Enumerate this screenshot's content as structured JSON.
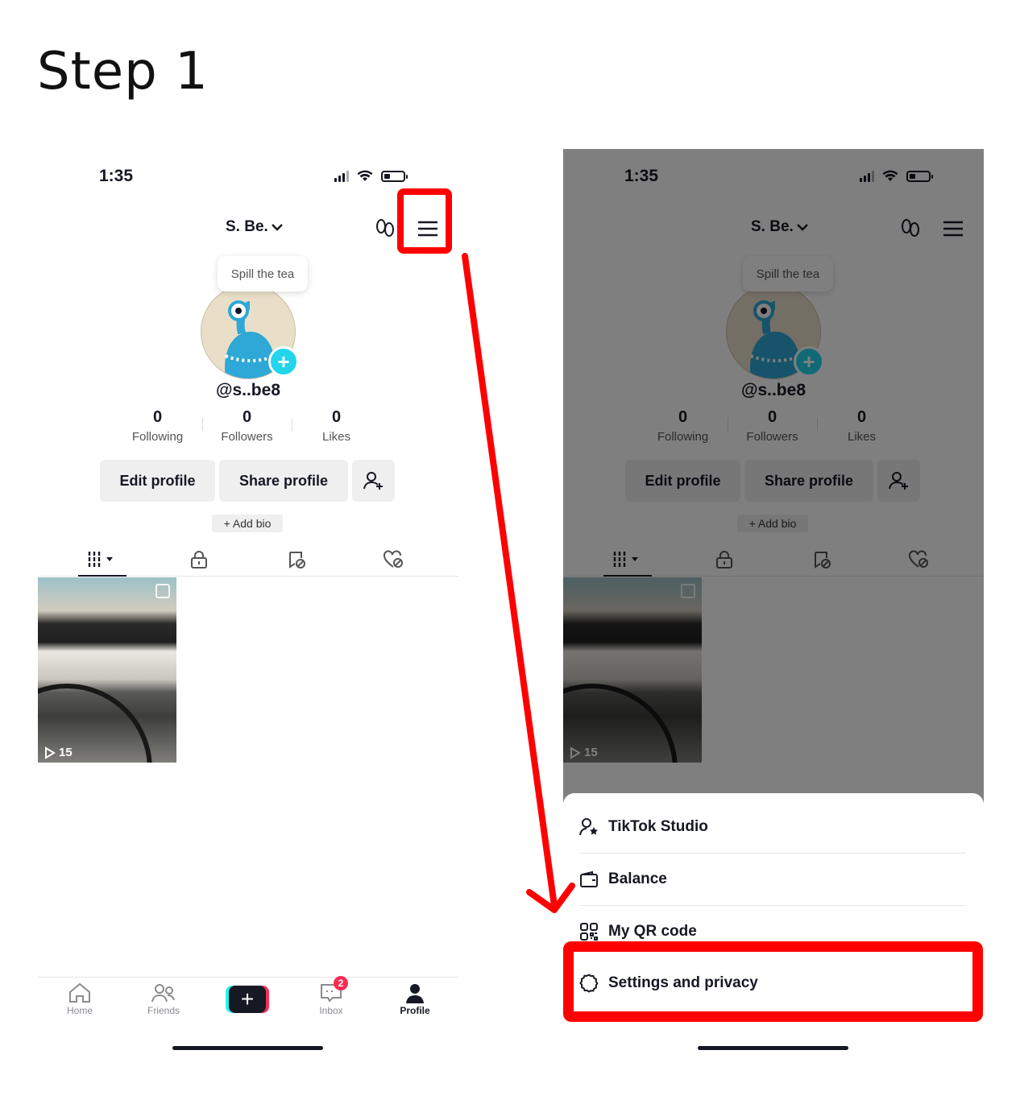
{
  "page_title": "Step 1",
  "status": {
    "time": "1:35"
  },
  "profile": {
    "display_name": "S. Be.",
    "bubble": "Spill the tea",
    "handle": "@s..be8",
    "stats": [
      {
        "value": "0",
        "label": "Following"
      },
      {
        "value": "0",
        "label": "Followers"
      },
      {
        "value": "0",
        "label": "Likes"
      }
    ],
    "edit_label": "Edit profile",
    "share_label": "Share profile",
    "add_bio": "+ Add bio",
    "video_views": "15"
  },
  "nav": {
    "home": "Home",
    "friends": "Friends",
    "inbox": "Inbox",
    "inbox_badge": "2",
    "profile": "Profile"
  },
  "menu": {
    "items": [
      {
        "label": "TikTok Studio",
        "icon": "person-star-icon"
      },
      {
        "label": "Balance",
        "icon": "wallet-icon"
      },
      {
        "label": "My QR code",
        "icon": "qr-code-icon"
      },
      {
        "label": "Settings and privacy",
        "icon": "gear-icon"
      }
    ]
  },
  "colors": {
    "highlight": "#ff0000",
    "accent_cyan": "#25f4ee",
    "accent_pink": "#fe2c55",
    "text": "#161823"
  }
}
